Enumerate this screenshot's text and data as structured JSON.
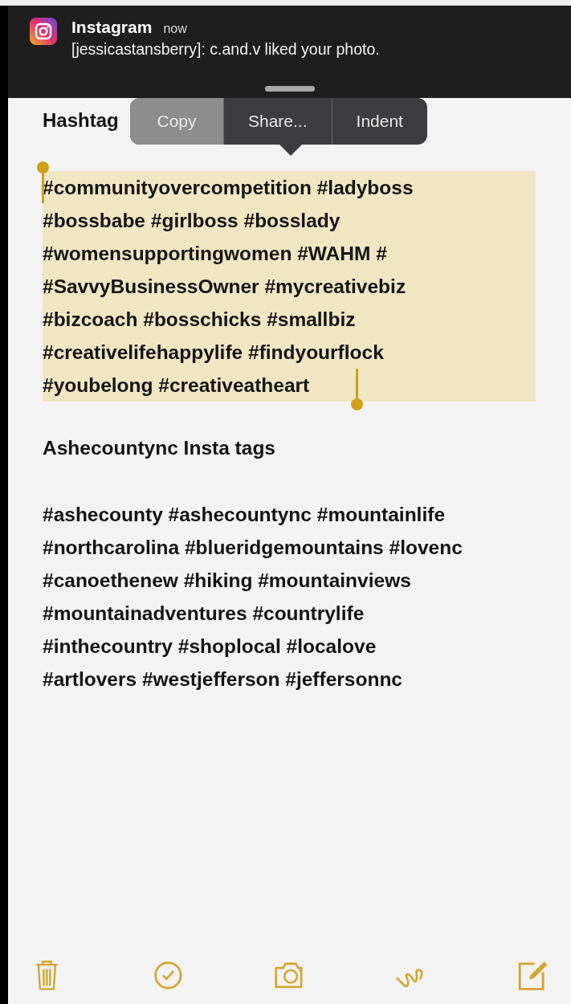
{
  "notification": {
    "app": "Instagram",
    "time": "now",
    "message": "[jessicastansberry]: c.and.v liked your photo."
  },
  "edit_menu": [
    {
      "label": "Copy",
      "pressed": true
    },
    {
      "label": "Share...",
      "pressed": false
    },
    {
      "label": "Indent",
      "pressed": false
    }
  ],
  "note": {
    "title": "Hashtag",
    "blocks": [
      {
        "kind": "paragraph",
        "selected": true,
        "lines": [
          "#communityovercompetition #ladyboss",
          "#bossbabe #girlboss #bosslady",
          "#womensupportingwomen #WAHM #",
          "#SavvyBusinessOwner #mycreativebiz",
          "#bizcoach #bosschicks #smallbiz",
          "#creativelifehappylife #findyourflock",
          "#youbelong #creativeatheart"
        ]
      },
      {
        "kind": "heading",
        "selected": false,
        "lines": [
          "Ashecountync Insta tags"
        ]
      },
      {
        "kind": "paragraph",
        "selected": false,
        "lines": [
          "#ashecounty #ashecountync #mountainlife",
          "#northcarolina #blueridgemountains #lovenc",
          "#canoethenew #hiking #mountainviews",
          "#mountainadventures #countrylife",
          "#inthecountry #shoplocal #localove",
          "#artlovers #westjefferson #jeffersonnc"
        ]
      }
    ]
  },
  "toolbar": [
    {
      "kind": "trash"
    },
    {
      "kind": "checklist"
    },
    {
      "kind": "camera"
    },
    {
      "kind": "sketch"
    },
    {
      "kind": "compose"
    }
  ]
}
